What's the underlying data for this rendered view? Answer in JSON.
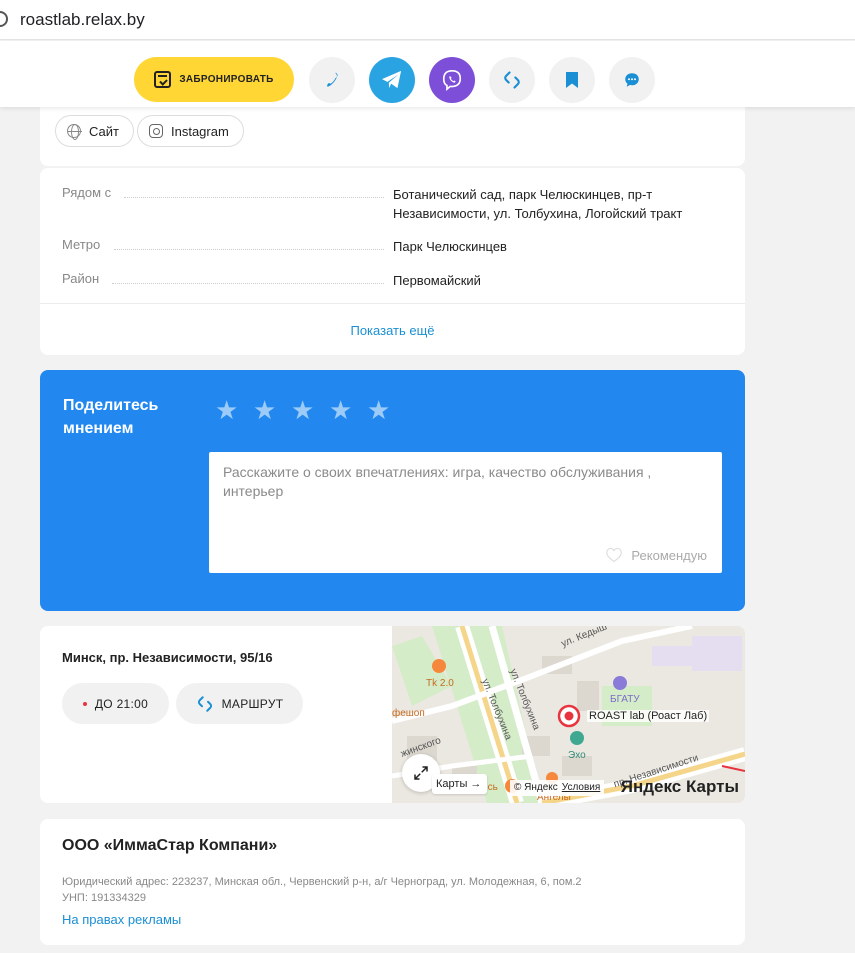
{
  "browser": {
    "url": "roastlab.relax.by"
  },
  "actions": {
    "book_label": "ЗАБРОНИРОВАТЬ",
    "colors": {
      "book": "#ffd633",
      "telegram": "#2aa3e2",
      "viber": "#7d4ed8",
      "icon_blue": "#1a8fd4"
    }
  },
  "links": {
    "site": "Сайт",
    "instagram": "Instagram"
  },
  "info": {
    "rows": [
      {
        "label": "Рядом с",
        "value": "Ботанический сад, парк Челюскинцев, пр-т Независимости, ул. Толбухина, Логойский тракт"
      },
      {
        "label": "Метро",
        "value": "Парк Челюскинцев"
      },
      {
        "label": "Район",
        "value": "Первомайский"
      }
    ],
    "show_more": "Показать ещё"
  },
  "review": {
    "title": "Поделитесь мнением",
    "stars_count": 5,
    "placeholder": "Расскажите о своих впечатлениях: игра, качество обслуживания , интерьер",
    "recommend": "Рекомендую",
    "bg_color": "#2288f0"
  },
  "location": {
    "address": "Минск, пр. Независимости, 95/16",
    "hours": "ДО 21:00",
    "route": "МАРШРУТ",
    "map": {
      "street_kedyshko": "ул. Кедыш",
      "street_tolbukhina_1": "ул. Толбухина",
      "street_tolbukhina_2": "ул. Толбухина",
      "street_nezavisimosti": "пр. Независимости",
      "poi_tk": "Tk 2.0",
      "poi_feshop": "фешоп",
      "poi_egatu": "БГАТУ",
      "poi_echo": "Эхо",
      "poi_angely": "Ангелы",
      "poi_zhinsky": "жинского",
      "poi_dis": "ись",
      "marker": "ROAST lab (Роаст Лаб)",
      "open_maps": "Карты →",
      "copyright": "© Яндекс",
      "terms": "Условия",
      "brand": "Яндекс Карты"
    }
  },
  "legal": {
    "company": "ООО «ИммаСтар Компани»",
    "address": "Юридический адрес: 223237, Минская обл., Червенский р-н, а/г Черноград, ул. Молодежная, 6, пом.2",
    "unp": "УНП: 191334329",
    "ad": "На правах рекламы"
  }
}
